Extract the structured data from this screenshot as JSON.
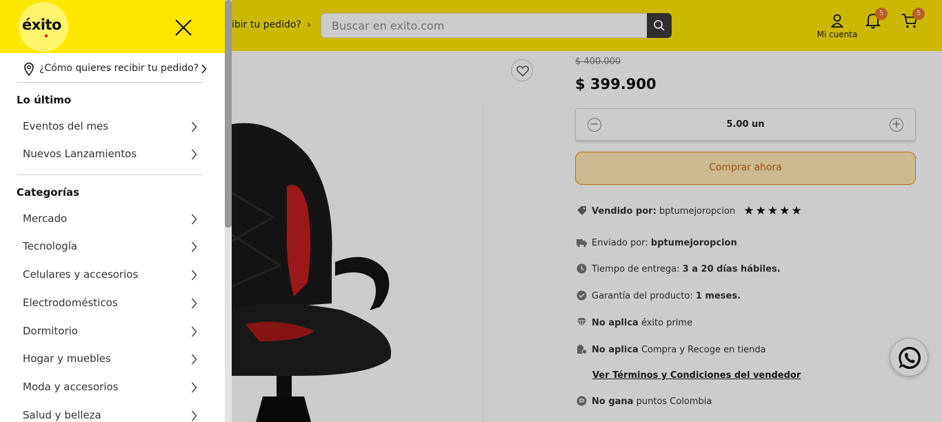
{
  "header": {
    "deliver_label": "ibir tu pedido?",
    "search_placeholder": "Buscar en exito.com",
    "account_label": "Mi cuenta",
    "notifications_count": "5",
    "cart_count": "5",
    "brand_color": "#ffe700"
  },
  "product": {
    "price_old": "$ 400.000",
    "price": "$ 399.900",
    "quantity": "5.00 un",
    "buy_label": "Comprar ahora",
    "sold_by_label": "Vendido por:",
    "sold_by": "bptumejoropcion",
    "rating_stars": "★★★★★",
    "shipped_by_label": "Enviado por:",
    "shipped_by": "bptumejoropcion",
    "delivery_label": "Tiempo de entrega:",
    "delivery_value": "3 a 20 días hábiles.",
    "warranty_label": "Garantía del producto:",
    "warranty_value": "1 meses.",
    "prime_strong": "No aplica",
    "prime_text": "éxito prime",
    "pickup_strong": "No aplica",
    "pickup_text": "Compra y Recoge en tienda",
    "terms_link": "Ver Términos y Condiciones del vendedor",
    "points_strong": "No gana",
    "points_text": "puntos Colombia"
  },
  "drawer": {
    "logo": "éxito",
    "deliver_question": "¿Cómo quieres recibir tu pedido?",
    "sections": [
      {
        "title": "Lo último",
        "items": [
          "Eventos del mes",
          "Nuevos Lanzamientos"
        ]
      },
      {
        "title": "Categorías",
        "items": [
          "Mercado",
          "Tecnología",
          "Celulares y accesorios",
          "Electrodomésticos",
          "Dormitorio",
          "Hogar y muebles",
          "Moda y accesorios",
          "Salud y belleza"
        ]
      }
    ]
  }
}
